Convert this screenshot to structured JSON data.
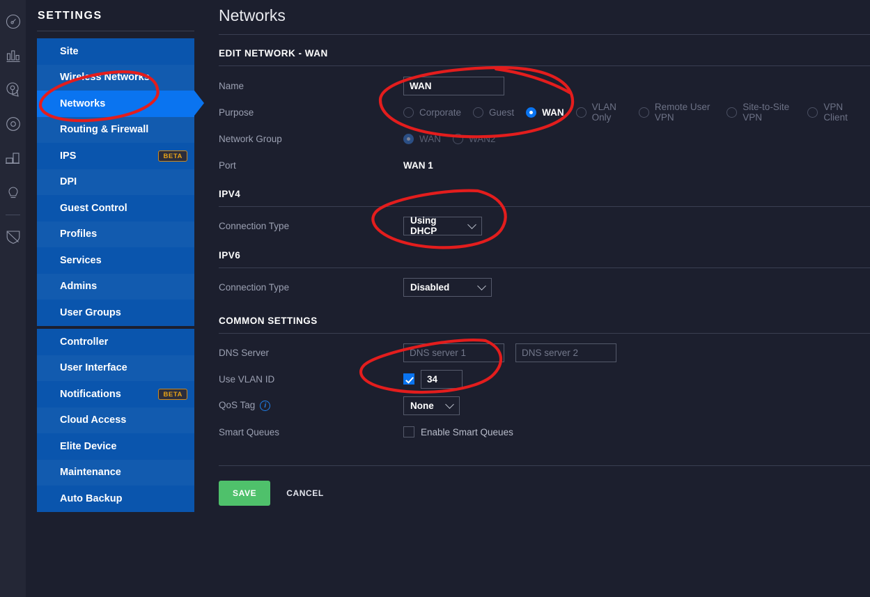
{
  "rail": {
    "icons": [
      {
        "name": "dashboard-gauge-icon"
      },
      {
        "name": "statistics-bar-chart-icon"
      },
      {
        "name": "map-pin-icon"
      },
      {
        "name": "devices-circle-icon"
      },
      {
        "name": "devices-stack-icon"
      },
      {
        "name": "clients-bulb-icon"
      },
      {
        "name": "shield-insights-icon"
      }
    ]
  },
  "sidebar": {
    "title": "SETTINGS",
    "group_a": [
      {
        "label": "Site",
        "badge": null,
        "active": false
      },
      {
        "label": "Wireless Networks",
        "badge": null,
        "active": false
      },
      {
        "label": "Networks",
        "badge": null,
        "active": true
      },
      {
        "label": "Routing & Firewall",
        "badge": null,
        "active": false
      },
      {
        "label": "IPS",
        "badge": "BETA",
        "active": false
      },
      {
        "label": "DPI",
        "badge": null,
        "active": false
      },
      {
        "label": "Guest Control",
        "badge": null,
        "active": false
      },
      {
        "label": "Profiles",
        "badge": null,
        "active": false
      },
      {
        "label": "Services",
        "badge": null,
        "active": false
      },
      {
        "label": "Admins",
        "badge": null,
        "active": false
      },
      {
        "label": "User Groups",
        "badge": null,
        "active": false
      }
    ],
    "group_b": [
      {
        "label": "Controller",
        "badge": null,
        "active": false
      },
      {
        "label": "User Interface",
        "badge": null,
        "active": false
      },
      {
        "label": "Notifications",
        "badge": "BETA",
        "active": false
      },
      {
        "label": "Cloud Access",
        "badge": null,
        "active": false
      },
      {
        "label": "Elite Device",
        "badge": null,
        "active": false
      },
      {
        "label": "Maintenance",
        "badge": null,
        "active": false
      },
      {
        "label": "Auto Backup",
        "badge": null,
        "active": false
      }
    ]
  },
  "main": {
    "page_title": "Networks",
    "edit_section_title": "EDIT NETWORK - WAN",
    "name": {
      "label": "Name",
      "value": "WAN"
    },
    "purpose": {
      "label": "Purpose",
      "options": [
        {
          "label": "Corporate",
          "selected": false
        },
        {
          "label": "Guest",
          "selected": false
        },
        {
          "label": "WAN",
          "selected": true
        },
        {
          "label": "VLAN Only",
          "selected": false
        },
        {
          "label": "Remote User VPN",
          "selected": false
        },
        {
          "label": "Site-to-Site VPN",
          "selected": false
        },
        {
          "label": "VPN Client",
          "selected": false
        }
      ]
    },
    "network_group": {
      "label": "Network Group",
      "options": [
        {
          "label": "WAN",
          "selected": true
        },
        {
          "label": "WAN2",
          "selected": false
        }
      ]
    },
    "port": {
      "label": "Port",
      "value": "WAN 1"
    },
    "ipv4": {
      "title": "IPV4",
      "connection_type_label": "Connection Type",
      "connection_type_value": "Using DHCP"
    },
    "ipv6": {
      "title": "IPV6",
      "connection_type_label": "Connection Type",
      "connection_type_value": "Disabled"
    },
    "common": {
      "title": "COMMON SETTINGS",
      "dns": {
        "label": "DNS Server",
        "server1_value": "",
        "server1_placeholder": "DNS server 1",
        "server2_value": "",
        "server2_placeholder": "DNS server 2"
      },
      "vlan": {
        "label": "Use VLAN ID",
        "checked": true,
        "value": "34"
      },
      "qos": {
        "label": "QoS Tag",
        "info_icon": "info-icon",
        "value": "None"
      },
      "smart_queues": {
        "label": "Smart Queues",
        "checkbox_label": "Enable Smart Queues",
        "checked": false
      }
    },
    "actions": {
      "save": "SAVE",
      "cancel": "CANCEL"
    }
  },
  "annotations": {
    "color": "#e31d1d",
    "marks": [
      "ellipse-around-networks-nav-item",
      "ellipse-around-name-and-purpose",
      "ellipse-around-ipv4-connection-type",
      "ellipse-around-use-vlan-id"
    ]
  },
  "colors": {
    "app_bg": "#1c1f2e",
    "rail_bg": "#242736",
    "nav_bg": "#0a55ad",
    "nav_active": "#0a74f0",
    "accent": "#0a74f0",
    "save_green": "#4fc16b",
    "beta_orange": "#e8a317",
    "annotation_red": "#e31d1d"
  }
}
